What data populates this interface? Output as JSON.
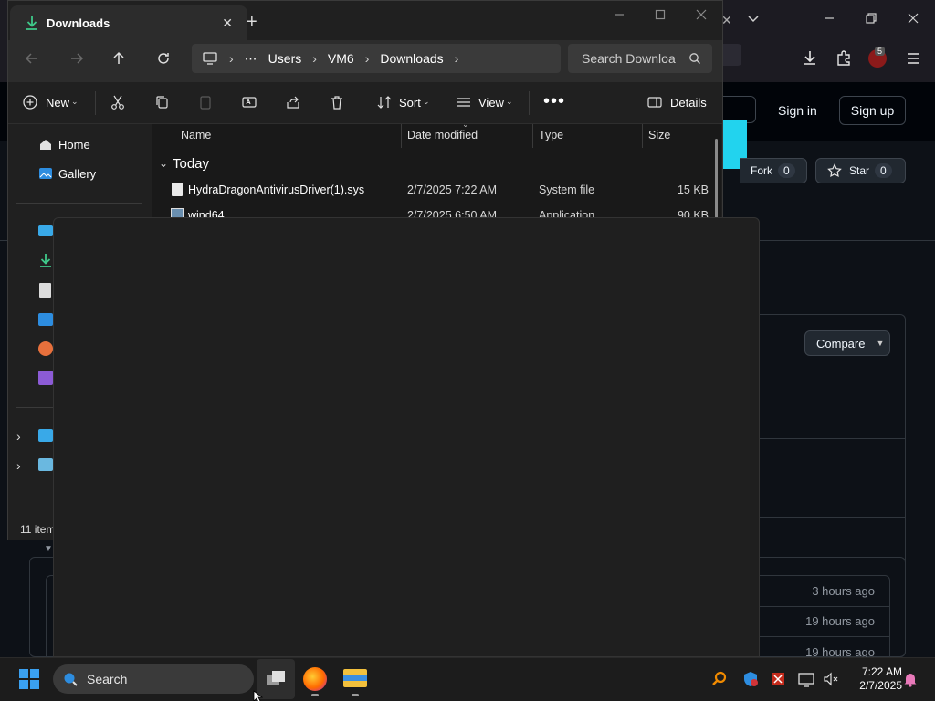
{
  "browser": {
    "github": {
      "sign_in": "Sign in",
      "sign_up": "Sign up",
      "fork_label": "Fork",
      "fork_count": "0",
      "star_label": "Star",
      "star_count": "0",
      "compare_label": "Compare",
      "rows": [
        {
          "time": "3 hours ago"
        },
        {
          "time": "19 hours ago"
        },
        {
          "time": "19 hours ago"
        }
      ]
    },
    "extension_badge": "5"
  },
  "explorer": {
    "tab_title": "Downloads",
    "breadcrumb": [
      "Users",
      "VM6",
      "Downloads"
    ],
    "search_placeholder": "Search Downloa",
    "toolbar": {
      "new_label": "New",
      "sort_label": "Sort",
      "view_label": "View",
      "details_label": "Details"
    },
    "nav": {
      "home": "Home",
      "gallery": "Gallery"
    },
    "columns": {
      "name": "Name",
      "date": "Date modified",
      "type": "Type",
      "size": "Size"
    },
    "group_label": "Today",
    "files": [
      {
        "name": "HydraDragonAntivirusDriver(1).sys",
        "date": "2/7/2025 7:22 AM",
        "type": "System file",
        "size": "15 KB"
      },
      {
        "name": "wind64",
        "date": "2/7/2025 6:50 AM",
        "type": "Application",
        "size": "90 KB"
      }
    ],
    "status": "11 item"
  },
  "taskbar": {
    "search_label": "Search",
    "time": "7:22 AM",
    "date": "2/7/2025"
  },
  "colors": {
    "accent": "#60cdff",
    "github_bg": "#0d1117",
    "explorer_bg": "#202020"
  }
}
